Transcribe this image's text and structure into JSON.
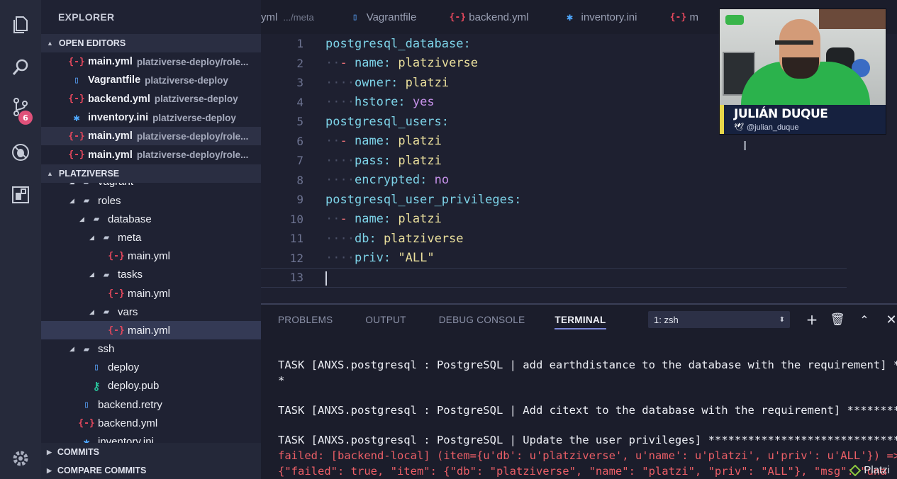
{
  "activitybar": {
    "scm_badge": "6"
  },
  "sidebar": {
    "title": "EXPLORER",
    "open_editors": {
      "header": "OPEN EDITORS",
      "items": [
        {
          "name": "main.yml",
          "path": "platziverse-deploy/role...",
          "icon": "yml-braces-icon"
        },
        {
          "name": "Vagrantfile",
          "path": "platziverse-deploy",
          "icon": "file-icon"
        },
        {
          "name": "backend.yml",
          "path": "platziverse-deploy",
          "icon": "yml-braces-icon"
        },
        {
          "name": "inventory.ini",
          "path": "platziverse-deploy",
          "icon": "gear-icon"
        },
        {
          "name": "main.yml",
          "path": "platziverse-deploy/role...",
          "icon": "yml-braces-icon"
        },
        {
          "name": "main.yml",
          "path": "platziverse-deploy/role...",
          "icon": "yml-braces-icon"
        }
      ]
    },
    "project": {
      "header": "PLATZIVERSE",
      "tree": [
        {
          "name": "vagrant",
          "type": "folder"
        },
        {
          "name": "roles",
          "type": "folder"
        },
        {
          "name": "database",
          "type": "folder"
        },
        {
          "name": "meta",
          "type": "folder"
        },
        {
          "name": "main.yml",
          "type": "yml"
        },
        {
          "name": "tasks",
          "type": "folder"
        },
        {
          "name": "main.yml",
          "type": "yml"
        },
        {
          "name": "vars",
          "type": "folder"
        },
        {
          "name": "main.yml",
          "type": "yml"
        },
        {
          "name": "ssh",
          "type": "folder"
        },
        {
          "name": "deploy",
          "type": "file"
        },
        {
          "name": "deploy.pub",
          "type": "key"
        },
        {
          "name": "backend.retry",
          "type": "file"
        },
        {
          "name": "backend.yml",
          "type": "yml"
        },
        {
          "name": "inventory.ini",
          "type": "gear"
        }
      ]
    },
    "commits_header": "COMMITS",
    "compare_header": "COMPARE COMMITS"
  },
  "tabs": [
    {
      "label": "yml",
      "path": ".../meta",
      "icon": ""
    },
    {
      "label": "Vagrantfile",
      "icon": "file-icon"
    },
    {
      "label": "backend.yml",
      "icon": "yml-braces-icon"
    },
    {
      "label": "inventory.ini",
      "icon": "gear-icon"
    },
    {
      "label": "m",
      "icon": "yml-braces-icon"
    }
  ],
  "editor": {
    "lines": [
      "postgresql_database:",
      "  - name: platziverse",
      "    owner: platzi",
      "    hstore: yes",
      "postgresql_users:",
      "  - name: platzi",
      "    pass: platzi",
      "    encrypted: no",
      "postgresql_user_privileges:",
      "  - name: platzi",
      "    db: platziverse",
      "    priv: \"ALL\"",
      ""
    ]
  },
  "panel": {
    "tabs": [
      "PROBLEMS",
      "OUTPUT",
      "DEBUG CONSOLE",
      "TERMINAL"
    ],
    "active_tab": "TERMINAL",
    "terminal_select": "1: zsh",
    "terminal_lines": [
      {
        "text": "TASK [ANXS.postgresql : PostgreSQL | add earthdistance to the database with the requirement] **",
        "kind": "normal"
      },
      {
        "text": "*",
        "kind": "normal"
      },
      {
        "text": "",
        "kind": "normal"
      },
      {
        "text": "TASK [ANXS.postgresql : PostgreSQL | Add citext to the database with the requirement] *********",
        "kind": "normal"
      },
      {
        "text": "",
        "kind": "normal"
      },
      {
        "text": "TASK [ANXS.postgresql : PostgreSQL | Update the user privileges] ******************************",
        "kind": "normal"
      },
      {
        "text": "failed: [backend-local] (item={u'db': u'platziverse', u'name': u'platzi', u'priv': u'ALL'}) =>",
        "kind": "error"
      },
      {
        "text": "{\"failed\": true, \"item\": {\"db\": \"platziverse\", \"name\": \"platzi\", \"priv\": \"ALL\"}, \"msg\": \"una",
        "kind": "error"
      }
    ]
  },
  "webcam": {
    "name": "JULIÁN DUQUE",
    "handle": "@julian_duque"
  },
  "watermark": "Platzi",
  "colors": {
    "accent": "#7c88d8",
    "error": "#ec5f67",
    "yaml_key": "#7dd3e8",
    "yaml_value": "#eadf9c"
  }
}
